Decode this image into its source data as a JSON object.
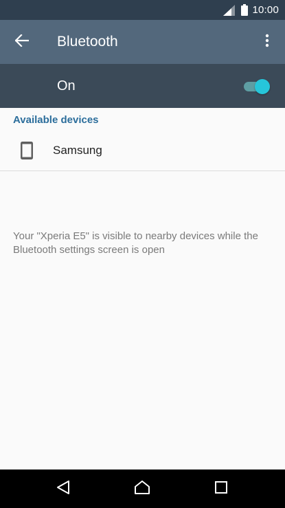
{
  "status_bar": {
    "time": "10:00",
    "icons": [
      "signal-icon",
      "battery-icon"
    ]
  },
  "app_bar": {
    "title": "Bluetooth",
    "back_icon": "arrow-left-icon",
    "menu_icon": "more-vert-icon"
  },
  "bluetooth_switch": {
    "label": "On",
    "state": "on",
    "accent_color": "#26c6da"
  },
  "available_devices": {
    "header": "Available devices",
    "devices": [
      {
        "name": "Samsung",
        "icon": "smartphone-icon"
      }
    ]
  },
  "visibility_message": "Your \"Xperia E5\" is visible to nearby devices while the Bluetooth settings screen is open",
  "navigation_bar": {
    "buttons": [
      "back-triangle-icon",
      "home-icon",
      "recents-square-icon"
    ]
  },
  "colors": {
    "status_bar": "#2f3f4f",
    "app_bar": "#53687c",
    "switch_bar": "#3b4a58",
    "section_header": "#2b6d9b",
    "background": "#fafafa"
  }
}
